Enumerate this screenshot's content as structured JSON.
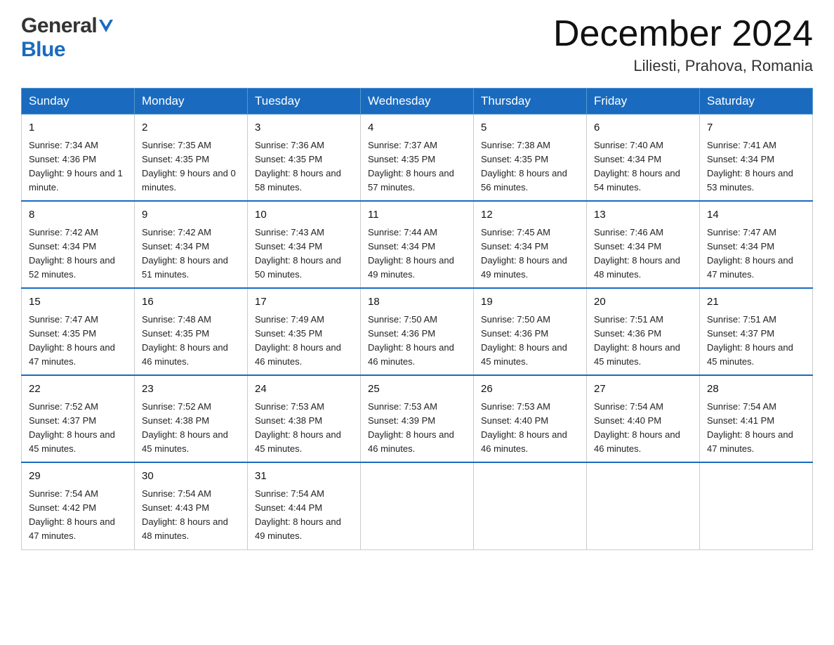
{
  "logo": {
    "general_text": "General",
    "blue_text": "Blue"
  },
  "header": {
    "month_year": "December 2024",
    "location": "Liliesti, Prahova, Romania"
  },
  "weekdays": [
    "Sunday",
    "Monday",
    "Tuesday",
    "Wednesday",
    "Thursday",
    "Friday",
    "Saturday"
  ],
  "weeks": [
    [
      {
        "day": "1",
        "sunrise": "7:34 AM",
        "sunset": "4:36 PM",
        "daylight": "9 hours and 1 minute."
      },
      {
        "day": "2",
        "sunrise": "7:35 AM",
        "sunset": "4:35 PM",
        "daylight": "9 hours and 0 minutes."
      },
      {
        "day": "3",
        "sunrise": "7:36 AM",
        "sunset": "4:35 PM",
        "daylight": "8 hours and 58 minutes."
      },
      {
        "day": "4",
        "sunrise": "7:37 AM",
        "sunset": "4:35 PM",
        "daylight": "8 hours and 57 minutes."
      },
      {
        "day": "5",
        "sunrise": "7:38 AM",
        "sunset": "4:35 PM",
        "daylight": "8 hours and 56 minutes."
      },
      {
        "day": "6",
        "sunrise": "7:40 AM",
        "sunset": "4:34 PM",
        "daylight": "8 hours and 54 minutes."
      },
      {
        "day": "7",
        "sunrise": "7:41 AM",
        "sunset": "4:34 PM",
        "daylight": "8 hours and 53 minutes."
      }
    ],
    [
      {
        "day": "8",
        "sunrise": "7:42 AM",
        "sunset": "4:34 PM",
        "daylight": "8 hours and 52 minutes."
      },
      {
        "day": "9",
        "sunrise": "7:42 AM",
        "sunset": "4:34 PM",
        "daylight": "8 hours and 51 minutes."
      },
      {
        "day": "10",
        "sunrise": "7:43 AM",
        "sunset": "4:34 PM",
        "daylight": "8 hours and 50 minutes."
      },
      {
        "day": "11",
        "sunrise": "7:44 AM",
        "sunset": "4:34 PM",
        "daylight": "8 hours and 49 minutes."
      },
      {
        "day": "12",
        "sunrise": "7:45 AM",
        "sunset": "4:34 PM",
        "daylight": "8 hours and 49 minutes."
      },
      {
        "day": "13",
        "sunrise": "7:46 AM",
        "sunset": "4:34 PM",
        "daylight": "8 hours and 48 minutes."
      },
      {
        "day": "14",
        "sunrise": "7:47 AM",
        "sunset": "4:34 PM",
        "daylight": "8 hours and 47 minutes."
      }
    ],
    [
      {
        "day": "15",
        "sunrise": "7:47 AM",
        "sunset": "4:35 PM",
        "daylight": "8 hours and 47 minutes."
      },
      {
        "day": "16",
        "sunrise": "7:48 AM",
        "sunset": "4:35 PM",
        "daylight": "8 hours and 46 minutes."
      },
      {
        "day": "17",
        "sunrise": "7:49 AM",
        "sunset": "4:35 PM",
        "daylight": "8 hours and 46 minutes."
      },
      {
        "day": "18",
        "sunrise": "7:50 AM",
        "sunset": "4:36 PM",
        "daylight": "8 hours and 46 minutes."
      },
      {
        "day": "19",
        "sunrise": "7:50 AM",
        "sunset": "4:36 PM",
        "daylight": "8 hours and 45 minutes."
      },
      {
        "day": "20",
        "sunrise": "7:51 AM",
        "sunset": "4:36 PM",
        "daylight": "8 hours and 45 minutes."
      },
      {
        "day": "21",
        "sunrise": "7:51 AM",
        "sunset": "4:37 PM",
        "daylight": "8 hours and 45 minutes."
      }
    ],
    [
      {
        "day": "22",
        "sunrise": "7:52 AM",
        "sunset": "4:37 PM",
        "daylight": "8 hours and 45 minutes."
      },
      {
        "day": "23",
        "sunrise": "7:52 AM",
        "sunset": "4:38 PM",
        "daylight": "8 hours and 45 minutes."
      },
      {
        "day": "24",
        "sunrise": "7:53 AM",
        "sunset": "4:38 PM",
        "daylight": "8 hours and 45 minutes."
      },
      {
        "day": "25",
        "sunrise": "7:53 AM",
        "sunset": "4:39 PM",
        "daylight": "8 hours and 46 minutes."
      },
      {
        "day": "26",
        "sunrise": "7:53 AM",
        "sunset": "4:40 PM",
        "daylight": "8 hours and 46 minutes."
      },
      {
        "day": "27",
        "sunrise": "7:54 AM",
        "sunset": "4:40 PM",
        "daylight": "8 hours and 46 minutes."
      },
      {
        "day": "28",
        "sunrise": "7:54 AM",
        "sunset": "4:41 PM",
        "daylight": "8 hours and 47 minutes."
      }
    ],
    [
      {
        "day": "29",
        "sunrise": "7:54 AM",
        "sunset": "4:42 PM",
        "daylight": "8 hours and 47 minutes."
      },
      {
        "day": "30",
        "sunrise": "7:54 AM",
        "sunset": "4:43 PM",
        "daylight": "8 hours and 48 minutes."
      },
      {
        "day": "31",
        "sunrise": "7:54 AM",
        "sunset": "4:44 PM",
        "daylight": "8 hours and 49 minutes."
      },
      null,
      null,
      null,
      null
    ]
  ],
  "labels": {
    "sunrise": "Sunrise:",
    "sunset": "Sunset:",
    "daylight": "Daylight:"
  }
}
